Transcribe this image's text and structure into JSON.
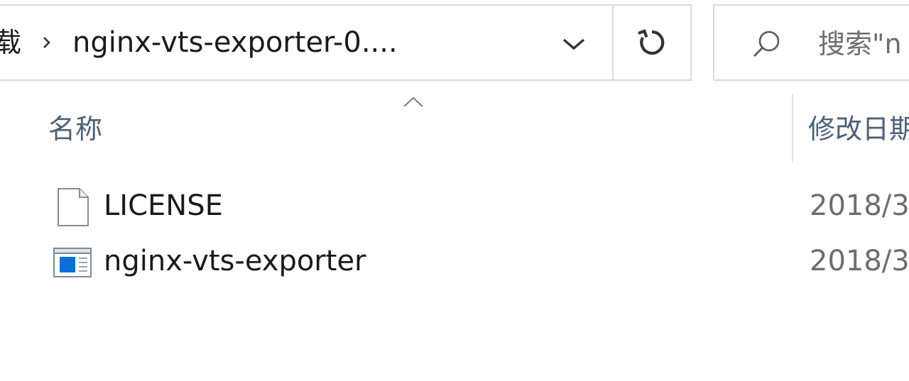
{
  "address_bar": {
    "previous_crumb": "载",
    "current_crumb": "nginx-vts-exporter-0...."
  },
  "search": {
    "placeholder": "搜索\"n"
  },
  "columns": {
    "name": "名称",
    "modified": "修改日期"
  },
  "files": [
    {
      "name": "LICENSE",
      "modified": "2018/3",
      "icon": "document-icon"
    },
    {
      "name": "nginx-vts-exporter",
      "modified": "2018/3",
      "icon": "application-icon"
    }
  ],
  "icons": {
    "separator": "chevron-right-icon",
    "dropdown": "chevron-down-icon",
    "refresh": "refresh-icon",
    "search": "search-icon",
    "sort": "sort-ascending-icon"
  },
  "colors": {
    "header_text": "#4c607a",
    "border": "#d9d9d9",
    "app_icon_blue": "#0a6fd8"
  }
}
